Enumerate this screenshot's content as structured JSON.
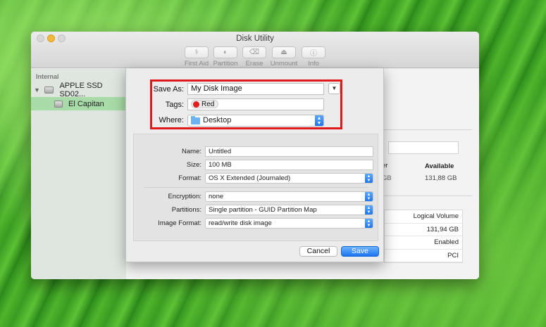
{
  "window": {
    "title": "Disk Utility"
  },
  "toolbar": [
    {
      "label": "First Aid",
      "icon": "stethoscope-icon"
    },
    {
      "label": "Partition",
      "icon": "partition-icon"
    },
    {
      "label": "Erase",
      "icon": "erase-icon"
    },
    {
      "label": "Unmount",
      "icon": "eject-icon"
    },
    {
      "label": "Info",
      "icon": "info-icon"
    }
  ],
  "sidebar": {
    "section": "Internal",
    "disk": "APPLE SSD SD02...",
    "volume": "El Capitan"
  },
  "background": {
    "used_label_partial": "er",
    "available_label": "Available",
    "used_value_partial": "GB",
    "available_value": "131,88 GB",
    "info_rows": [
      "Logical Volume",
      "131,94 GB",
      "Enabled",
      "PCI"
    ]
  },
  "dialog": {
    "save_as_label": "Save As:",
    "save_as_value": "My Disk Image",
    "tags_label": "Tags:",
    "tag": {
      "name": "Red",
      "color": "#e31c1c"
    },
    "where_label": "Where:",
    "where_value": "Desktop",
    "name_label": "Name:",
    "name_value": "Untitled",
    "size_label": "Size:",
    "size_value": "100 MB",
    "format_label": "Format:",
    "format_value": "OS X Extended (Journaled)",
    "encryption_label": "Encryption:",
    "encryption_value": "none",
    "partitions_label": "Partitions:",
    "partitions_value": "Single partition - GUID Partition Map",
    "image_format_label": "Image Format:",
    "image_format_value": "read/write disk image",
    "cancel_label": "Cancel",
    "save_label": "Save"
  },
  "colors": {
    "highlight": "#e01a1a",
    "accent": "#1e77f2",
    "sidebar_selected": "#a8dba8"
  }
}
